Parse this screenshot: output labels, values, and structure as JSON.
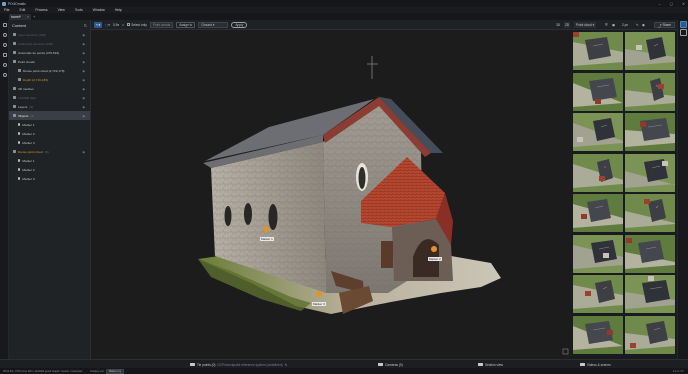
{
  "app": {
    "title": "PIX4Dmatic"
  },
  "window_controls": [
    "–",
    "▢",
    "✕"
  ],
  "menu": [
    "File",
    "Edit",
    "Process",
    "View",
    "Tools",
    "Window",
    "Help"
  ],
  "tab": {
    "label": "barrel*",
    "close": "×",
    "add": "+"
  },
  "panel": {
    "title": "Content",
    "items": [
      {
        "label": "Input cameras (198)",
        "dim": true,
        "indent": 0
      },
      {
        "label": "Calibrated cameras (198)",
        "dim": true,
        "indent": 0
      },
      {
        "label": "Automatic tie points (476,519)",
        "dim": false,
        "indent": 0
      },
      {
        "label": "Point clouds",
        "dim": false,
        "indent": 0
      },
      {
        "label": "Dense point cloud (2,719,179)",
        "dim": false,
        "indent": 1
      },
      {
        "label": "Depth (2,719,189)",
        "dim": false,
        "indent": 1,
        "orange": true
      },
      {
        "label": "3D meshes",
        "dim": false,
        "indent": 0
      },
      {
        "label": "LAS/DB data",
        "dim": true,
        "indent": 0
      },
      {
        "label": "Layers",
        "dim": false,
        "indent": 0,
        "count": "(1)"
      },
      {
        "label": "Objects",
        "dim": false,
        "indent": 0,
        "count": "(3)",
        "selected": true
      },
      {
        "label": "Marker 1",
        "dim": false,
        "indent": 1,
        "marker": true
      },
      {
        "label": "Marker 2",
        "dim": false,
        "indent": 1,
        "marker": true
      },
      {
        "label": "Marker 3",
        "dim": false,
        "indent": 1,
        "marker": true
      },
      {
        "label": "Dense point cloud",
        "dim": false,
        "indent": 0,
        "count": "(3)",
        "orange": true
      },
      {
        "label": "Marker 1",
        "dim": false,
        "indent": 1,
        "marker": true
      },
      {
        "label": "Marker 2",
        "dim": false,
        "indent": 1,
        "marker": true
      },
      {
        "label": "Marker 3",
        "dim": false,
        "indent": 1,
        "marker": true
      }
    ]
  },
  "toolbar": {
    "zoom": "0.5",
    "select_only": "Select only",
    "select_placeholder": "Point clouds",
    "assign_to": "Assign to",
    "assign_value": "Ground",
    "apply": "Apply",
    "view_3d": "3D",
    "view_2d": "2D",
    "view_mode": "Point cloud",
    "point_size": "2 px",
    "share": "Share",
    "avatar": "P"
  },
  "viewport": {
    "markers": [
      "Marker 1",
      "Marker 2",
      "Marker 3"
    ]
  },
  "gallery": {
    "thumb_count": 16
  },
  "bottom": {
    "tie_points": "Tie points (0)",
    "tie_points_note": "GCP/checkpoint reference system (undefined)",
    "cameras": "Cameras (0)",
    "section_view": "Section view",
    "videos_scenes": "Videos & scenes"
  },
  "status": {
    "text": "WGS 84 / UTM zone 32N + EGM96 geoid height / meters / Cartesian",
    "display_label": "Display unit",
    "display_value": "Meters (m)",
    "right": "3.4 m / 9°"
  },
  "colors": {
    "accent": "#2f5a8f",
    "orange": "#e0902f",
    "bg": "#1b1d20"
  }
}
